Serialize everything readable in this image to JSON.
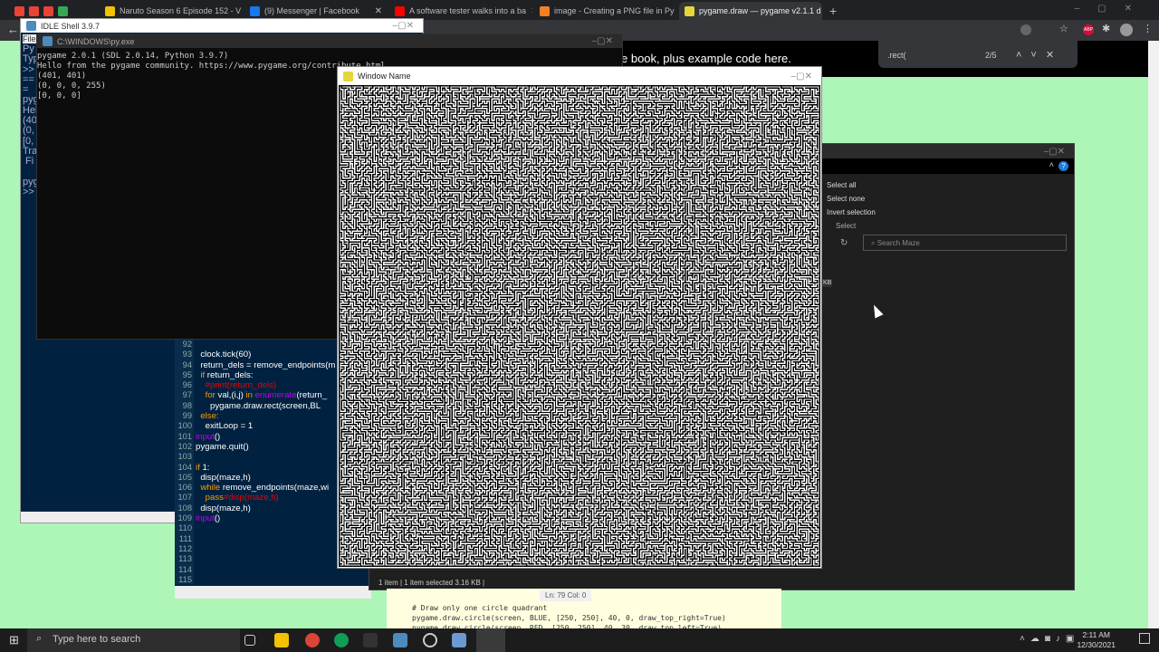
{
  "browser": {
    "tabs": [
      {
        "label": "Naruto Season 6 Episode 152 - V",
        "color": "#f2c200"
      },
      {
        "label": "(9) Messenger | Facebook",
        "color": "#1877f2"
      },
      {
        "label": "A software tester walks into a ba",
        "color": "#ff0000"
      },
      {
        "label": "image - Creating a PNG file in Py",
        "color": "#f48024"
      },
      {
        "label": "pygame.draw — pygame v2.1.1 d",
        "color": "#e6d63a"
      }
    ],
    "new_tab": "+",
    "page_text": "e book, plus example code here.",
    "find": {
      "query": ".rect(",
      "count": "2/5"
    },
    "extension_label": "ABP"
  },
  "idle": {
    "title": "IDLE Shell 3.9.7",
    "menu": "File",
    "side_text": "Py\nTyp\n>>\n==\n=\npyg\nHel\n(40\n(0,\n[0,\nTra\n Fi\n  \npyg\n>>"
  },
  "console": {
    "title": "C:\\WINDOWS\\py.exe",
    "lines": "pygame 2.0.1 (SDL 2.0.14, Python 3.9.7)\nHello from the pygame community. https://www.pygame.org/contribute.html\n(401, 401)\n(0, 0, 0, 255)\n[0, 0, 0]"
  },
  "editor": {
    "line_numbers": "92\n93\n94\n95\n96\n97\n98\n99\n100\n101\n102\n103\n104\n105\n106\n107\n108\n109\n110\n111\n112\n113\n114\n115",
    "lines": [
      {
        "t": ""
      },
      {
        "t": "  clock.tick(60)"
      },
      {
        "t": "  return_dels = remove_endpoints(m"
      },
      {
        "k": "  if ",
        "t": "return_dels:"
      },
      {
        "c": "    #print(return_dels)"
      },
      {
        "k": "    for ",
        "t": "val,(i,j) ",
        "k2": "in ",
        "b": "enumerate",
        "t2": "(return_"
      },
      {
        "t": "      pygame.draw.rect(screen,BL"
      },
      {
        "k": "  else:"
      },
      {
        "t": "    exitLoop = 1"
      },
      {
        "b": "input",
        "t2": "()"
      },
      {
        "t": "pygame.quit()"
      },
      {
        "t": ""
      },
      {
        "k": "if ",
        "t": "1:"
      },
      {
        "t": "  disp(maze,h)"
      },
      {
        "k": "  while ",
        "t": "remove_endpoints(maze,wi"
      },
      {
        "k": "    pass",
        "c": "#disp(maze,h)"
      },
      {
        "t": "  disp(maze,h)"
      },
      {
        "b": "input",
        "t2": "()"
      }
    ]
  },
  "pygame_window": {
    "title": "Window Name",
    "size": "401 x 401"
  },
  "explorer": {
    "select_all": "Select all",
    "select_none": "Select none",
    "invert": "Invert selection",
    "group": "Select",
    "search_placeholder": "Search Maze",
    "kb": "KB",
    "status": "1 item  |  1 item selected  3.16 KB  |"
  },
  "ln_col": "Ln: 79   Col: 0",
  "docs_code": "# Draw only one circle quadrant\npygame.draw.circle(screen, BLUE, [250, 250], 40, 0, draw_top_right=True)\npygame.draw.circle(screen, RED, [250, 250], 40, 30, draw_top_left=True)",
  "taskbar": {
    "search_placeholder": "Type here to search",
    "time": "2:11 AM",
    "date": "12/30/2021"
  }
}
